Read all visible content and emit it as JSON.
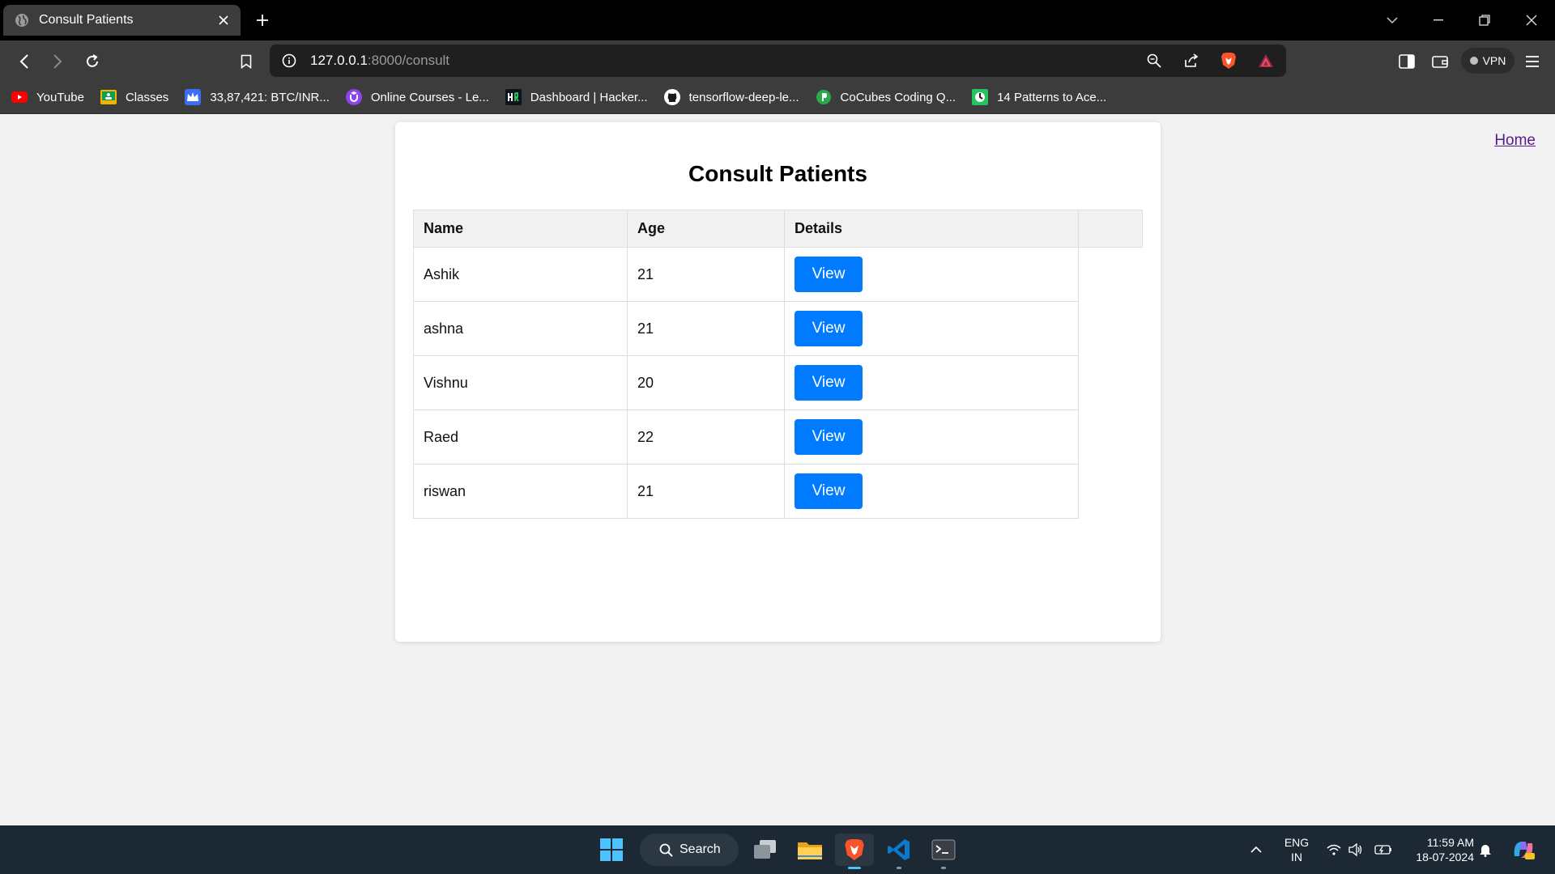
{
  "browser": {
    "tab_title": "Consult Patients",
    "url_host": "127.0.0.1",
    "url_rest": ":8000/consult",
    "vpn_label": "VPN",
    "bookmarks": [
      {
        "label": "YouTube",
        "icon": "youtube-icon",
        "color": "#ff0000"
      },
      {
        "label": "Classes",
        "icon": "google-classroom-icon",
        "color": "#f4b400"
      },
      {
        "label": "33,87,421: BTC/INR...",
        "icon": "crown-icon",
        "color": "#3d6df2"
      },
      {
        "label": "Online Courses - Le...",
        "icon": "udemy-icon",
        "color": "#8e44ec"
      },
      {
        "label": "Dashboard | Hacker...",
        "icon": "hackerrank-icon",
        "color": "#0e141e"
      },
      {
        "label": "tensorflow-deep-le...",
        "icon": "github-icon",
        "color": "#ffffff"
      },
      {
        "label": "CoCubes Coding Q...",
        "icon": "cocubes-icon",
        "color": "#2ba84a"
      },
      {
        "label": "14 Patterns to Ace...",
        "icon": "pattern-icon",
        "color": "#22c55e"
      }
    ]
  },
  "page": {
    "home_link": "Home",
    "title": "Consult Patients",
    "table": {
      "headers": [
        "Name",
        "Age",
        "Details"
      ],
      "rows": [
        {
          "name": "Ashik",
          "age": "21",
          "action": "View"
        },
        {
          "name": "ashna",
          "age": "21",
          "action": "View"
        },
        {
          "name": "Vishnu",
          "age": "20",
          "action": "View"
        },
        {
          "name": "Raed",
          "age": "22",
          "action": "View"
        },
        {
          "name": "riswan",
          "age": "21",
          "action": "View"
        }
      ]
    }
  },
  "taskbar": {
    "search_label": "Search",
    "language_line1": "ENG",
    "language_line2": "IN",
    "time": "11:59 AM",
    "date": "18-07-2024"
  },
  "colors": {
    "accent_button": "#007bff",
    "link_visited": "#551a8b"
  }
}
